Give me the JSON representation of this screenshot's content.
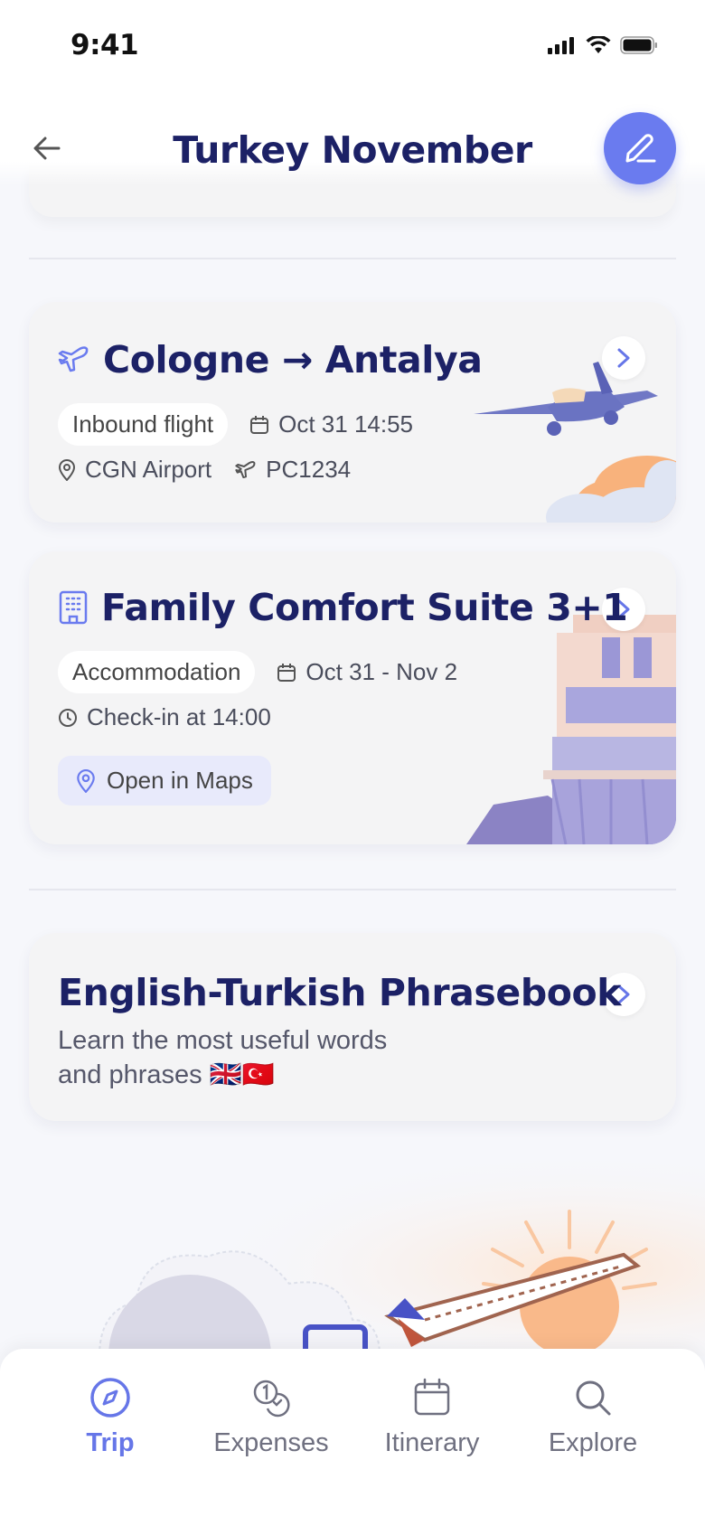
{
  "status": {
    "time": "9:41"
  },
  "header": {
    "title": "Turkey November"
  },
  "flight": {
    "title": "Cologne → Antalya",
    "tag": "Inbound flight",
    "date": "Oct 31 14:55",
    "airport": "CGN Airport",
    "flight_no": "PC1234"
  },
  "hotel": {
    "title": "Family Comfort Suite 3+1",
    "tag": "Accommodation",
    "dates": "Oct 31 - Nov 2",
    "checkin": "Check-in at 14:00",
    "maps_label": "Open in Maps"
  },
  "phrasebook": {
    "title": "English-Turkish Phrasebook",
    "line1": "Learn the most useful words",
    "line2": "and phrases 🇬🇧🇹🇷"
  },
  "tabs": [
    {
      "label": "Trip",
      "icon": "compass-icon",
      "active": true
    },
    {
      "label": "Expenses",
      "icon": "coins-icon",
      "active": false
    },
    {
      "label": "Itinerary",
      "icon": "calendar-icon",
      "active": false
    },
    {
      "label": "Explore",
      "icon": "search-icon",
      "active": false
    }
  ],
  "colors": {
    "accent": "#6a7bef",
    "title": "#1c2166",
    "card": "#f4f4f5",
    "background": "#f6f7fb"
  }
}
